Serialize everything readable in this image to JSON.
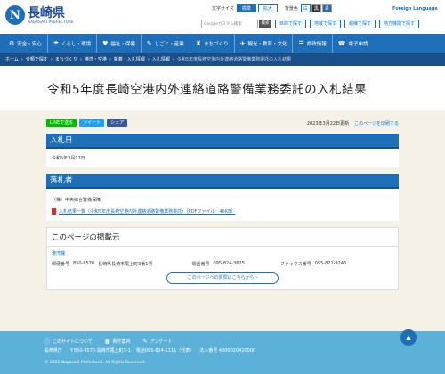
{
  "header": {
    "logo_mark": "N",
    "logo_ja": "長崎県",
    "logo_en": "NAGASAKI PREFECTURE",
    "text_size_label": "文字サイズ",
    "text_size_standard": "標準",
    "text_size_large": "拡大",
    "bg_label": "背景色",
    "bg_white": "白",
    "bg_black": "黒",
    "bg_blue": "青",
    "foreign_language": "Foreign Language",
    "search_placeholder": "Googleカスタム検索",
    "search_button": "検索",
    "quick_links": [
      "目的で探す",
      "地域で探す",
      "組織で探す",
      "地方機関で探す"
    ]
  },
  "global_nav": [
    {
      "icon": "⚙",
      "label": "安全・安心"
    },
    {
      "icon": "☂",
      "label": "くらし・環境"
    },
    {
      "icon": "♥",
      "label": "福祉・保健"
    },
    {
      "icon": "✎",
      "label": "しごと・産業"
    },
    {
      "icon": "♜",
      "label": "まちづくり"
    },
    {
      "icon": "✈",
      "label": "観光・教育・文化"
    },
    {
      "icon": "☰",
      "label": "県政情報"
    },
    {
      "icon": "☎",
      "label": "電子申請"
    }
  ],
  "breadcrumb": [
    "ホーム",
    "分類で探す",
    "まちづくり",
    "港湾・空港",
    "新着・入札情報",
    "入札情報",
    "令和5年度長崎空港内外連絡道路警備業務委託の入札結果"
  ],
  "page": {
    "title": "令和5年度長崎空港内外連絡道路警備業務委託の入札結果",
    "share_line": "LINEで送る",
    "share_tweet": "ツイート",
    "share_fb": "シェア",
    "updated": "2023年3月22日更新",
    "print_link": "このページを印刷する"
  },
  "sections": {
    "bid_date_heading": "入札日",
    "bid_date": "令和5年3月17日",
    "winner_heading": "落札者",
    "winner": "（株）中央綜合警備保障",
    "pdf_link": "入札結果一覧（令和5年度長崎空港内外連絡道路警備業務委託）［PDFファイル／46KB］"
  },
  "contact": {
    "heading": "このページの掲載元",
    "dept": "港湾課",
    "postal_label": "郵便番号",
    "postal": "850-8570",
    "address": "長崎県長崎市尾上町3番1号",
    "phone_label": "電話番号",
    "phone": "095-824-3625",
    "fax_label": "ファックス番号",
    "fax": "095-821-9246",
    "inquiry_button": "このページへの質問はこちらから"
  },
  "footer": {
    "link_about": "このサイトについて",
    "link_office": "県庁案内",
    "link_survey": "アンケート",
    "pref_name": "長崎県庁",
    "postal": "〒850-8570 長崎市尾上町3-1",
    "phone": "電話095-824-1111（代表）",
    "corp_no": "法人番号 4000020420000",
    "copyright": "© 2021 Nagasaki Prefectural. All Rights Reserved."
  },
  "colors": {
    "brand": "#1e6fb8",
    "breadcrumb_bg": "#1b4f8a",
    "footer_bg": "#5cb1d9"
  }
}
